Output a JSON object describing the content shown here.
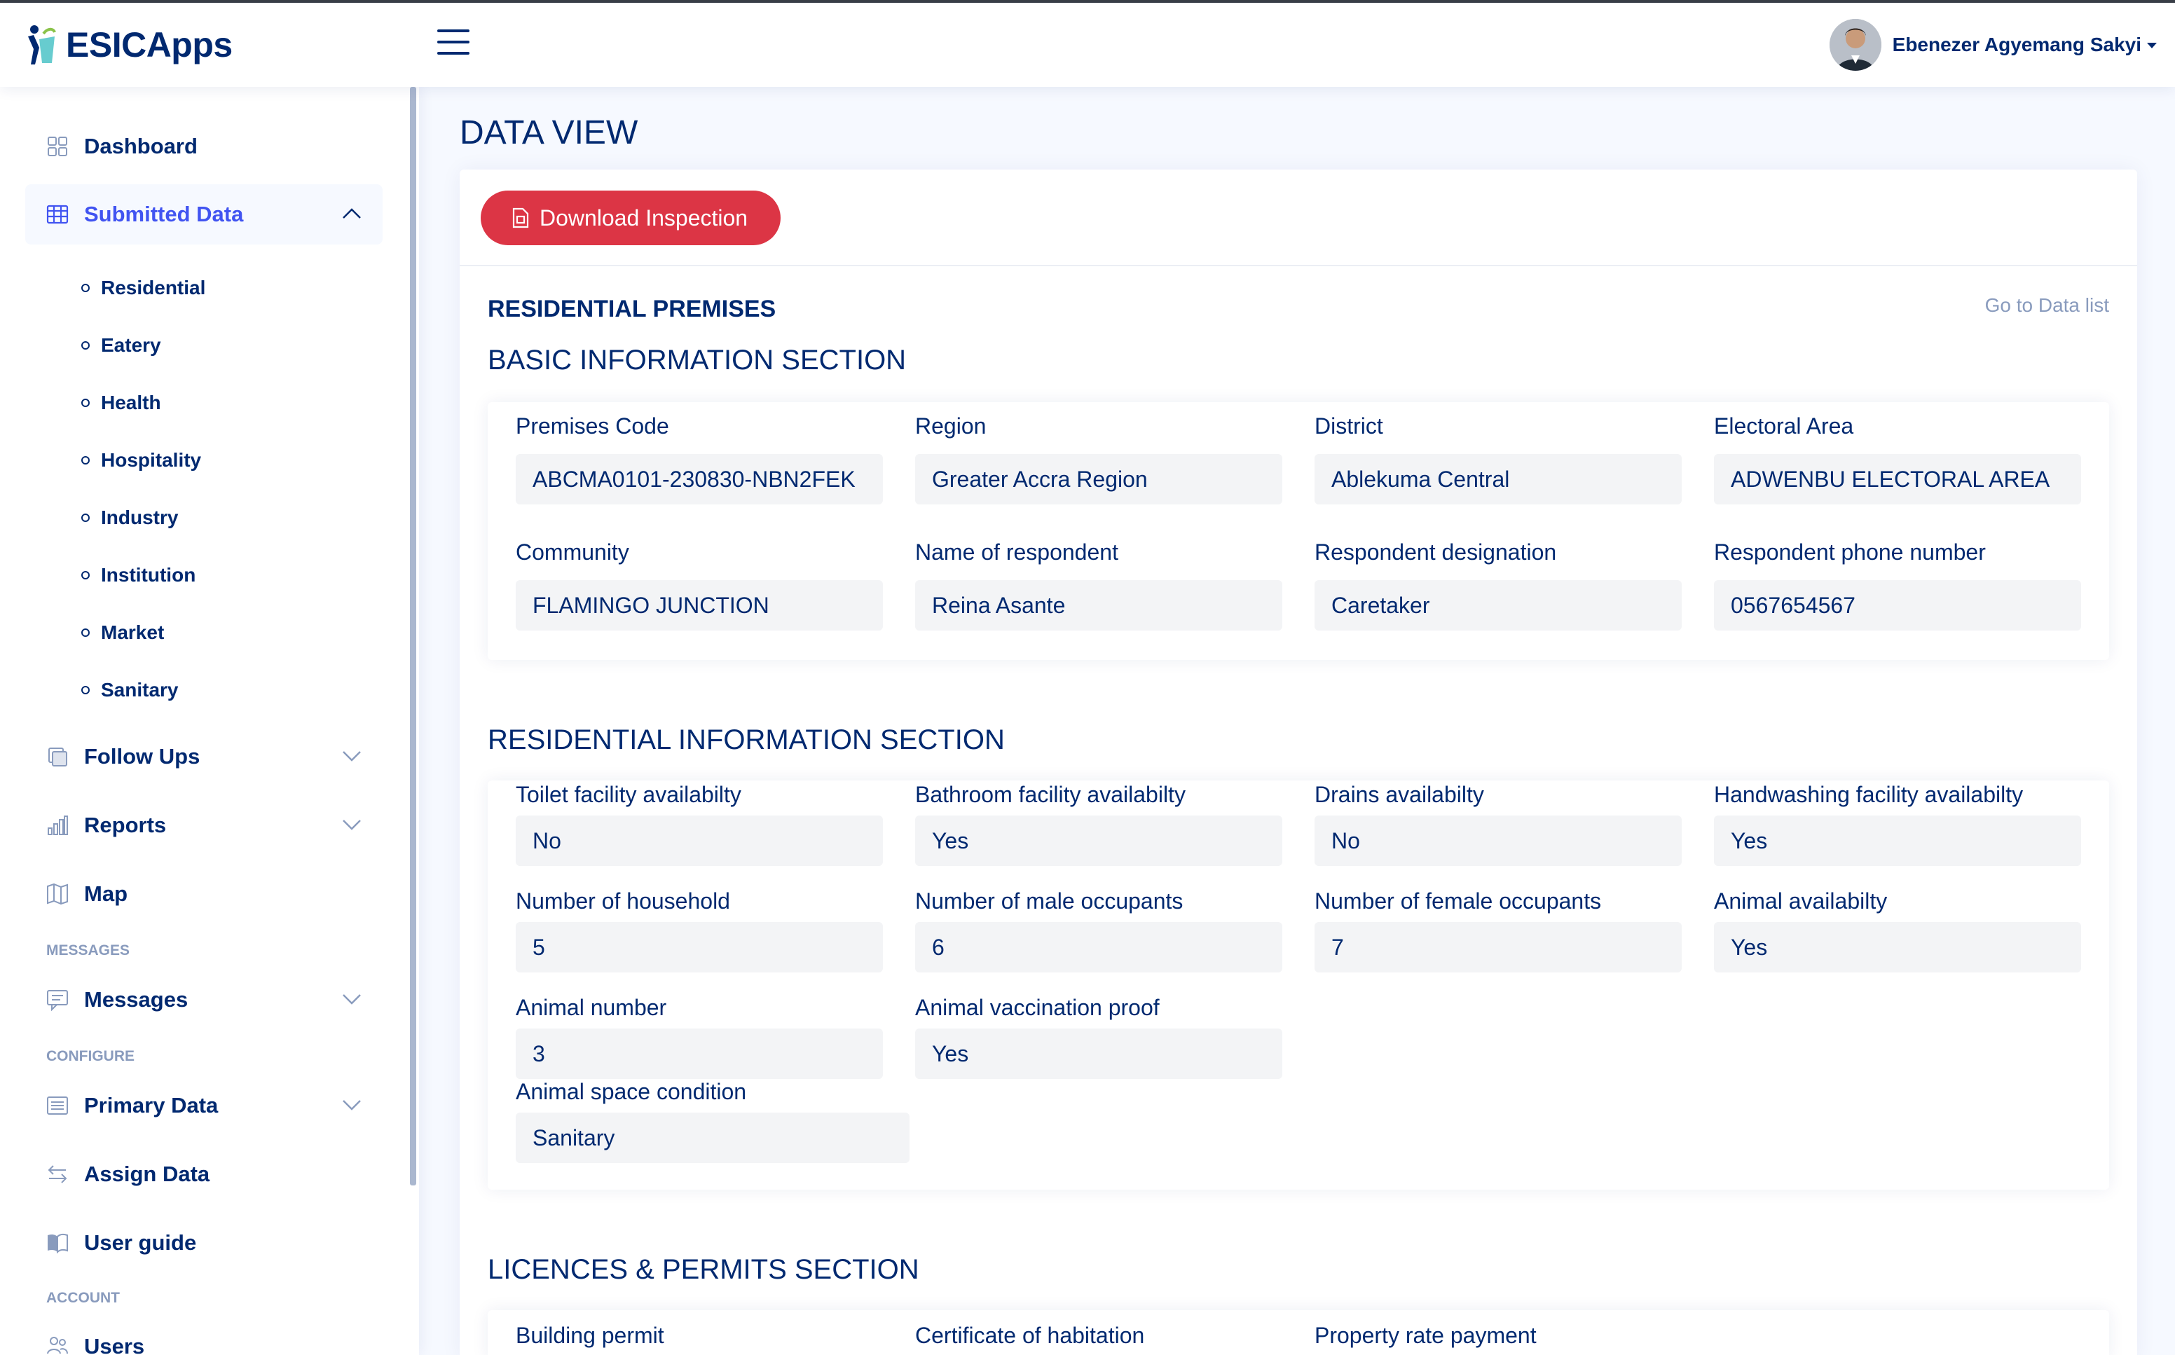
{
  "app": {
    "name": "ESICApps"
  },
  "user": {
    "name": "Ebenezer Agyemang Sakyi"
  },
  "sidebar": {
    "items": [
      {
        "label": "Dashboard",
        "icon": "grid-icon"
      },
      {
        "label": "Submitted Data",
        "icon": "table-icon"
      },
      {
        "label": "Follow Ups",
        "icon": "layers-icon"
      },
      {
        "label": "Reports",
        "icon": "bar-chart-icon"
      },
      {
        "label": "Map",
        "icon": "map-icon"
      },
      {
        "label": "Messages",
        "icon": "chat-icon"
      },
      {
        "label": "Primary Data",
        "icon": "list-icon"
      },
      {
        "label": "Assign Data",
        "icon": "arrows-icon"
      },
      {
        "label": "User guide",
        "icon": "book-icon"
      },
      {
        "label": "Users",
        "icon": "people-icon"
      }
    ],
    "submitted_sub": [
      "Residential",
      "Eatery",
      "Health",
      "Hospitality",
      "Industry",
      "Institution",
      "Market",
      "Sanitary"
    ],
    "headings": {
      "messages": "MESSAGES",
      "configure": "CONFIGURE",
      "account": "ACCOUNT"
    }
  },
  "main": {
    "page_title": "DATA VIEW",
    "download_label": "Download Inspection",
    "premises_title": "RESIDENTIAL PREMISES",
    "go_link": "Go to Data list",
    "basic": {
      "title": "BASIC INFORMATION SECTION",
      "fields": [
        {
          "label": "Premises Code",
          "value": "ABCMA0101-230830-NBN2FEK"
        },
        {
          "label": "Region",
          "value": "Greater Accra Region"
        },
        {
          "label": "District",
          "value": "Ablekuma Central"
        },
        {
          "label": "Electoral Area",
          "value": "ADWENBU ELECTORAL AREA"
        },
        {
          "label": "Community",
          "value": "FLAMINGO JUNCTION"
        },
        {
          "label": "Name of respondent",
          "value": "Reina Asante"
        },
        {
          "label": "Respondent designation",
          "value": "Caretaker"
        },
        {
          "label": "Respondent phone number",
          "value": "0567654567"
        }
      ]
    },
    "residential": {
      "title": "RESIDENTIAL INFORMATION SECTION",
      "fields": [
        {
          "label": "Toilet facility availabilty",
          "value": "No"
        },
        {
          "label": "Bathroom facility availabilty",
          "value": "Yes"
        },
        {
          "label": "Drains availabilty",
          "value": "No"
        },
        {
          "label": "Handwashing facility availabilty",
          "value": "Yes"
        },
        {
          "label": "Number of household",
          "value": "5"
        },
        {
          "label": "Number of male occupants",
          "value": "6"
        },
        {
          "label": "Number of female occupants",
          "value": "7"
        },
        {
          "label": "Animal availabilty",
          "value": "Yes"
        },
        {
          "label": "Animal number",
          "value": "3"
        },
        {
          "label": "Animal vaccination proof",
          "value": "Yes"
        },
        {
          "label": "Animal space condition",
          "value": "Sanitary"
        }
      ]
    },
    "licences": {
      "title": "LICENCES & PERMITS SECTION",
      "fields": [
        {
          "label": "Building permit"
        },
        {
          "label": "Certificate of habitation"
        },
        {
          "label": "Property rate payment"
        }
      ]
    }
  },
  "colors": {
    "primary": "#012970",
    "active": "#4154f1",
    "danger": "#dc3545",
    "muted": "#899bbd"
  }
}
